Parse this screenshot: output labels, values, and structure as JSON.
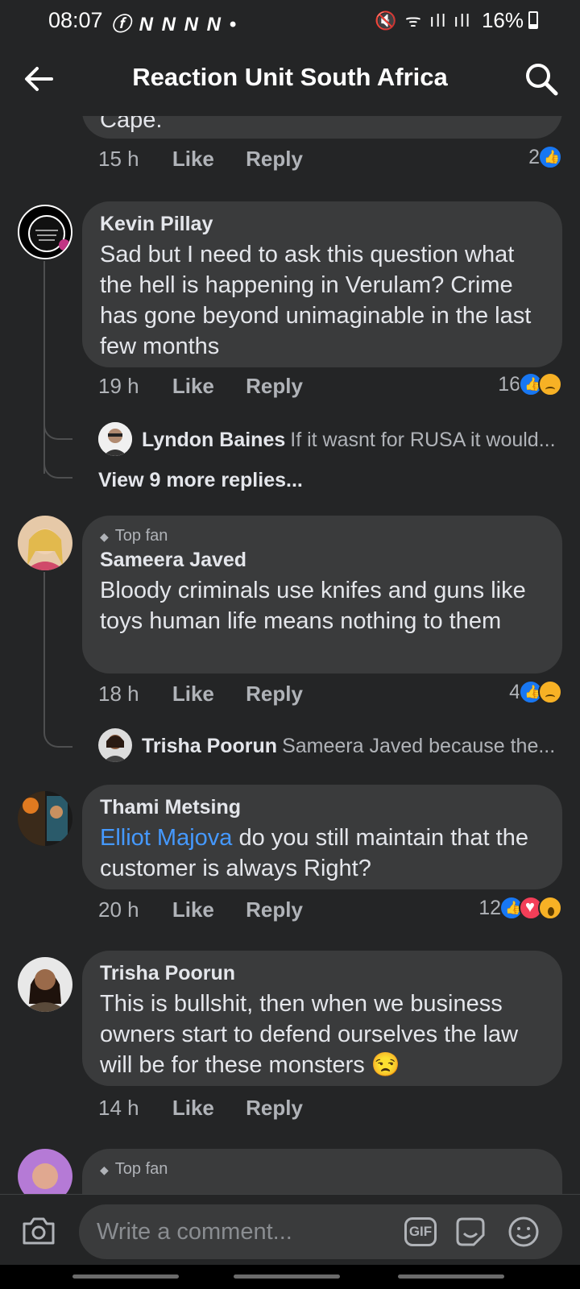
{
  "status": {
    "time": "08:07",
    "notifications": "ⓕ N N N N •",
    "battery": "16%",
    "icons": "mute-icon wifi-icon signal-icon"
  },
  "header": {
    "title": "Reaction Unit South Africa"
  },
  "comments": [
    {
      "fragment": "Cape.",
      "time": "15 h",
      "like": "Like",
      "reply": "Reply",
      "reactions": "2",
      "reaction_icons": [
        "like"
      ]
    },
    {
      "name": "Kevin Pillay",
      "text": "Sad but I need to ask this question what the hell is happening in Verulam? Crime has gone beyond unimaginable in the last few months",
      "time": "19 h",
      "like": "Like",
      "reply": "Reply",
      "reactions": "16",
      "reaction_icons": [
        "like",
        "sad"
      ],
      "reply_preview": {
        "name": "Lyndon Baines",
        "text": "If it wasnt for RUSA it would..."
      },
      "more_replies": "View 9 more replies..."
    },
    {
      "badge": "Top fan",
      "name": "Sameera Javed",
      "text": "Bloody criminals use knifes and guns like toys human life means nothing to them",
      "time": "18 h",
      "like": "Like",
      "reply": "Reply",
      "reactions": "4",
      "reaction_icons": [
        "like",
        "sad"
      ],
      "reply_preview": {
        "name": "Trisha Poorun",
        "text": "Sameera Javed because the..."
      }
    },
    {
      "name": "Thami Metsing",
      "mention": "Elliot Majova",
      "text": "do you still maintain that the customer is always Right?",
      "time": "20 h",
      "like": "Like",
      "reply": "Reply",
      "reactions": "12",
      "reaction_icons": [
        "like",
        "love",
        "wow"
      ]
    },
    {
      "name": "Trisha Poorun",
      "text": "This is bullshit, then when we business owners start to defend ourselves the law will be for these monsters 😒",
      "time": "14 h",
      "like": "Like",
      "reply": "Reply"
    },
    {
      "badge": "Top fan"
    }
  ],
  "composer": {
    "placeholder": "Write a comment...",
    "gif": "GIF"
  },
  "colors": {
    "background": "#242526",
    "bubble": "#3a3b3c",
    "link": "#4599ff",
    "like": "#1877f2"
  }
}
